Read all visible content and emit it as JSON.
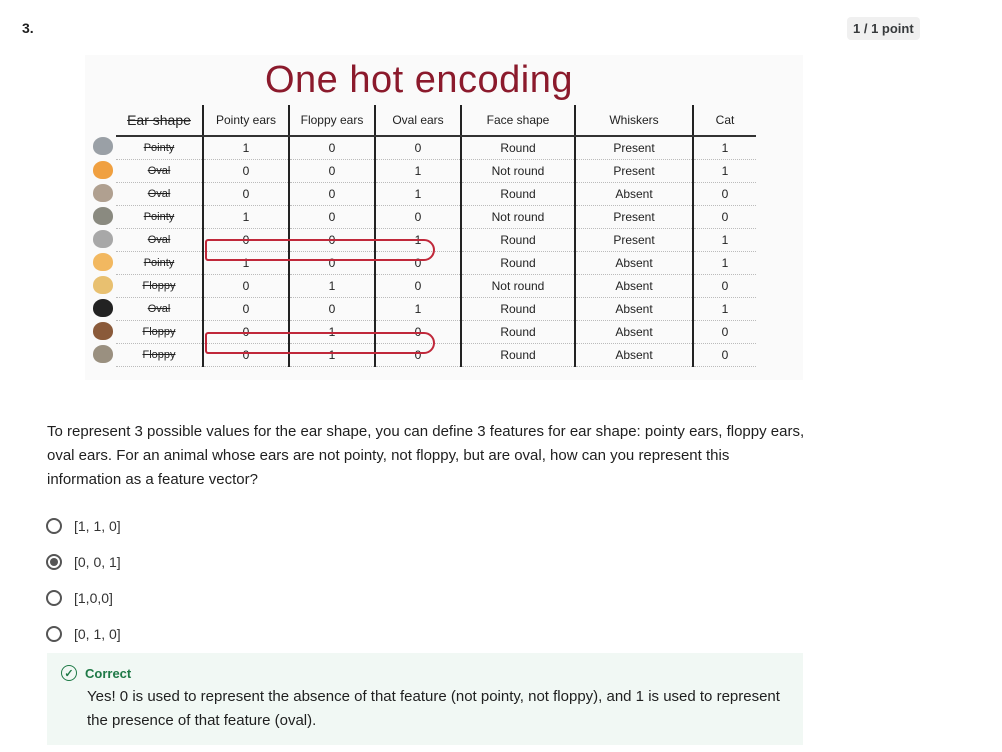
{
  "question": {
    "number": "3.",
    "points": "1 / 1 point",
    "text": "To represent 3 possible values for the ear shape, you can define 3 features for ear shape: pointy ears, floppy ears, oval ears. For an animal whose ears are not pointy, not floppy, but are oval, how can you represent this information as a feature vector?"
  },
  "figure": {
    "title": "One hot encoding",
    "headers": [
      "Ear shape",
      "Pointy ears",
      "Floppy ears",
      "Oval ears",
      "Face shape",
      "Whiskers",
      "Cat"
    ],
    "rows": [
      {
        "animal_color": "#9aa0a6",
        "ear": "Pointy",
        "pointy": "1",
        "floppy": "0",
        "oval": "0",
        "face": "Round",
        "whiskers": "Present",
        "cat": "1"
      },
      {
        "animal_color": "#f0a040",
        "ear": "Oval",
        "pointy": "0",
        "floppy": "0",
        "oval": "1",
        "face": "Not round",
        "whiskers": "Present",
        "cat": "1"
      },
      {
        "animal_color": "#b0a090",
        "ear": "Oval",
        "pointy": "0",
        "floppy": "0",
        "oval": "1",
        "face": "Round",
        "whiskers": "Absent",
        "cat": "0"
      },
      {
        "animal_color": "#8a8a80",
        "ear": "Pointy",
        "pointy": "1",
        "floppy": "0",
        "oval": "0",
        "face": "Not round",
        "whiskers": "Present",
        "cat": "0"
      },
      {
        "animal_color": "#a8a8a8",
        "ear": "Oval",
        "pointy": "0",
        "floppy": "0",
        "oval": "1",
        "face": "Round",
        "whiskers": "Present",
        "cat": "1"
      },
      {
        "animal_color": "#f2b860",
        "ear": "Pointy",
        "pointy": "1",
        "floppy": "0",
        "oval": "0",
        "face": "Round",
        "whiskers": "Absent",
        "cat": "1"
      },
      {
        "animal_color": "#e8c070",
        "ear": "Floppy",
        "pointy": "0",
        "floppy": "1",
        "oval": "0",
        "face": "Not round",
        "whiskers": "Absent",
        "cat": "0"
      },
      {
        "animal_color": "#222222",
        "ear": "Oval",
        "pointy": "0",
        "floppy": "0",
        "oval": "1",
        "face": "Round",
        "whiskers": "Absent",
        "cat": "1"
      },
      {
        "animal_color": "#8a5a3a",
        "ear": "Floppy",
        "pointy": "0",
        "floppy": "1",
        "oval": "0",
        "face": "Round",
        "whiskers": "Absent",
        "cat": "0"
      },
      {
        "animal_color": "#9a9080",
        "ear": "Floppy",
        "pointy": "0",
        "floppy": "1",
        "oval": "0",
        "face": "Round",
        "whiskers": "Absent",
        "cat": "0"
      }
    ]
  },
  "options": [
    {
      "label": "[1, 1, 0]",
      "selected": false
    },
    {
      "label": "[0, 0, 1]",
      "selected": true
    },
    {
      "label": "[1,0,0]",
      "selected": false
    },
    {
      "label": "[0, 1, 0]",
      "selected": false
    }
  ],
  "feedback": {
    "status": "Correct",
    "text": "Yes! 0 is used to represent the absence of that feature (not pointy, not floppy), and 1 is used to represent the presence of that feature (oval).",
    "color": "#1f7a47"
  }
}
